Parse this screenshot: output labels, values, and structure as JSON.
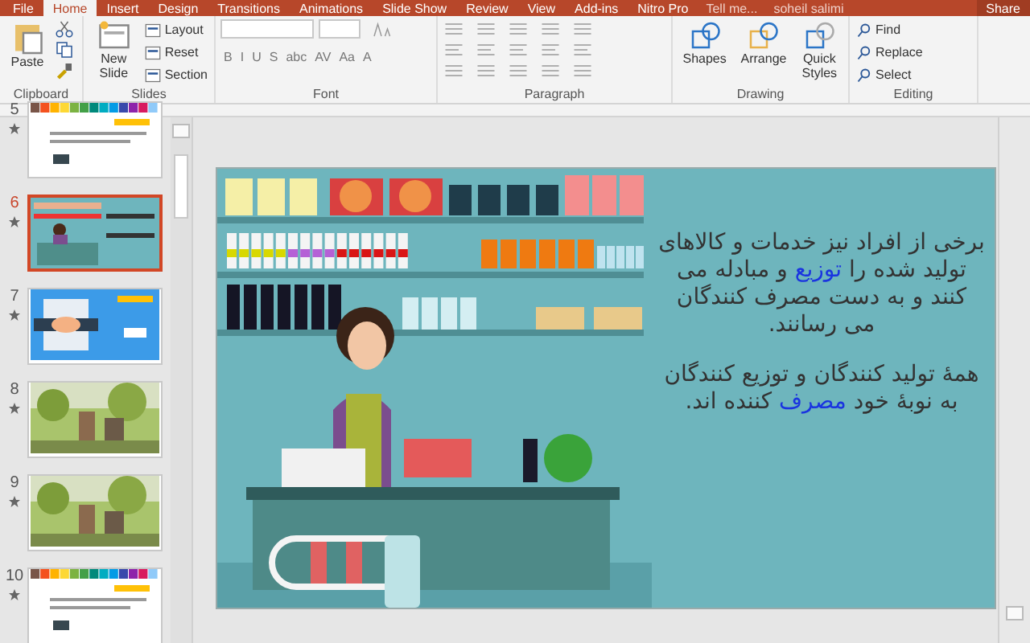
{
  "tabs": [
    {
      "label": "File",
      "selected": false
    },
    {
      "label": "Home",
      "selected": true
    },
    {
      "label": "Insert",
      "selected": false
    },
    {
      "label": "Design",
      "selected": false
    },
    {
      "label": "Transitions",
      "selected": false
    },
    {
      "label": "Animations",
      "selected": false
    },
    {
      "label": "Slide Show",
      "selected": false
    },
    {
      "label": "Review",
      "selected": false
    },
    {
      "label": "View",
      "selected": false
    },
    {
      "label": "Add-ins",
      "selected": false
    },
    {
      "label": "Nitro Pro",
      "selected": false
    }
  ],
  "tell_me": "Tell me...",
  "user": "soheil salimi",
  "share": "Share",
  "ribbon": {
    "clipboard": {
      "label": "Clipboard",
      "paste": "Paste"
    },
    "slides": {
      "label": "Slides",
      "new_slide": "New Slide",
      "items": [
        "Layout",
        "Reset",
        "Section"
      ]
    },
    "font": {
      "label": "Font",
      "buttons": [
        "B",
        "I",
        "U",
        "S",
        "abc",
        "AV",
        "Aa",
        "A"
      ]
    },
    "paragraph": {
      "label": "Paragraph"
    },
    "drawing": {
      "label": "Drawing",
      "buttons": [
        "Shapes",
        "Arrange",
        "Quick Styles"
      ]
    },
    "editing": {
      "label": "Editing",
      "items": [
        "Find",
        "Replace",
        "Select"
      ]
    }
  },
  "thumbnails": [
    {
      "number": "5",
      "selected": false,
      "kind": "chart"
    },
    {
      "number": "6",
      "selected": true,
      "kind": "shop"
    },
    {
      "number": "7",
      "selected": false,
      "kind": "handshake"
    },
    {
      "number": "8",
      "selected": false,
      "kind": "picture"
    },
    {
      "number": "9",
      "selected": false,
      "kind": "picture"
    },
    {
      "number": "10",
      "selected": false,
      "kind": "chart"
    }
  ],
  "slide": {
    "paragraphs": [
      [
        {
          "text": "برخی از افراد نیز خدمات و کالاهای تولید شده را ",
          "highlight": false
        },
        {
          "text": "توزیع",
          "highlight": true
        },
        {
          "text": " و مبادله می کنند و به دست مصرف کنندگان می رسانند.",
          "highlight": false
        }
      ],
      [
        {
          "text": "همهٔ تولید کنندگان و توزیع کنندگان به نوبهٔ خود ",
          "highlight": false
        },
        {
          "text": "مصرف",
          "highlight": true
        },
        {
          "text": " کننده اند.",
          "highlight": false
        }
      ]
    ]
  }
}
